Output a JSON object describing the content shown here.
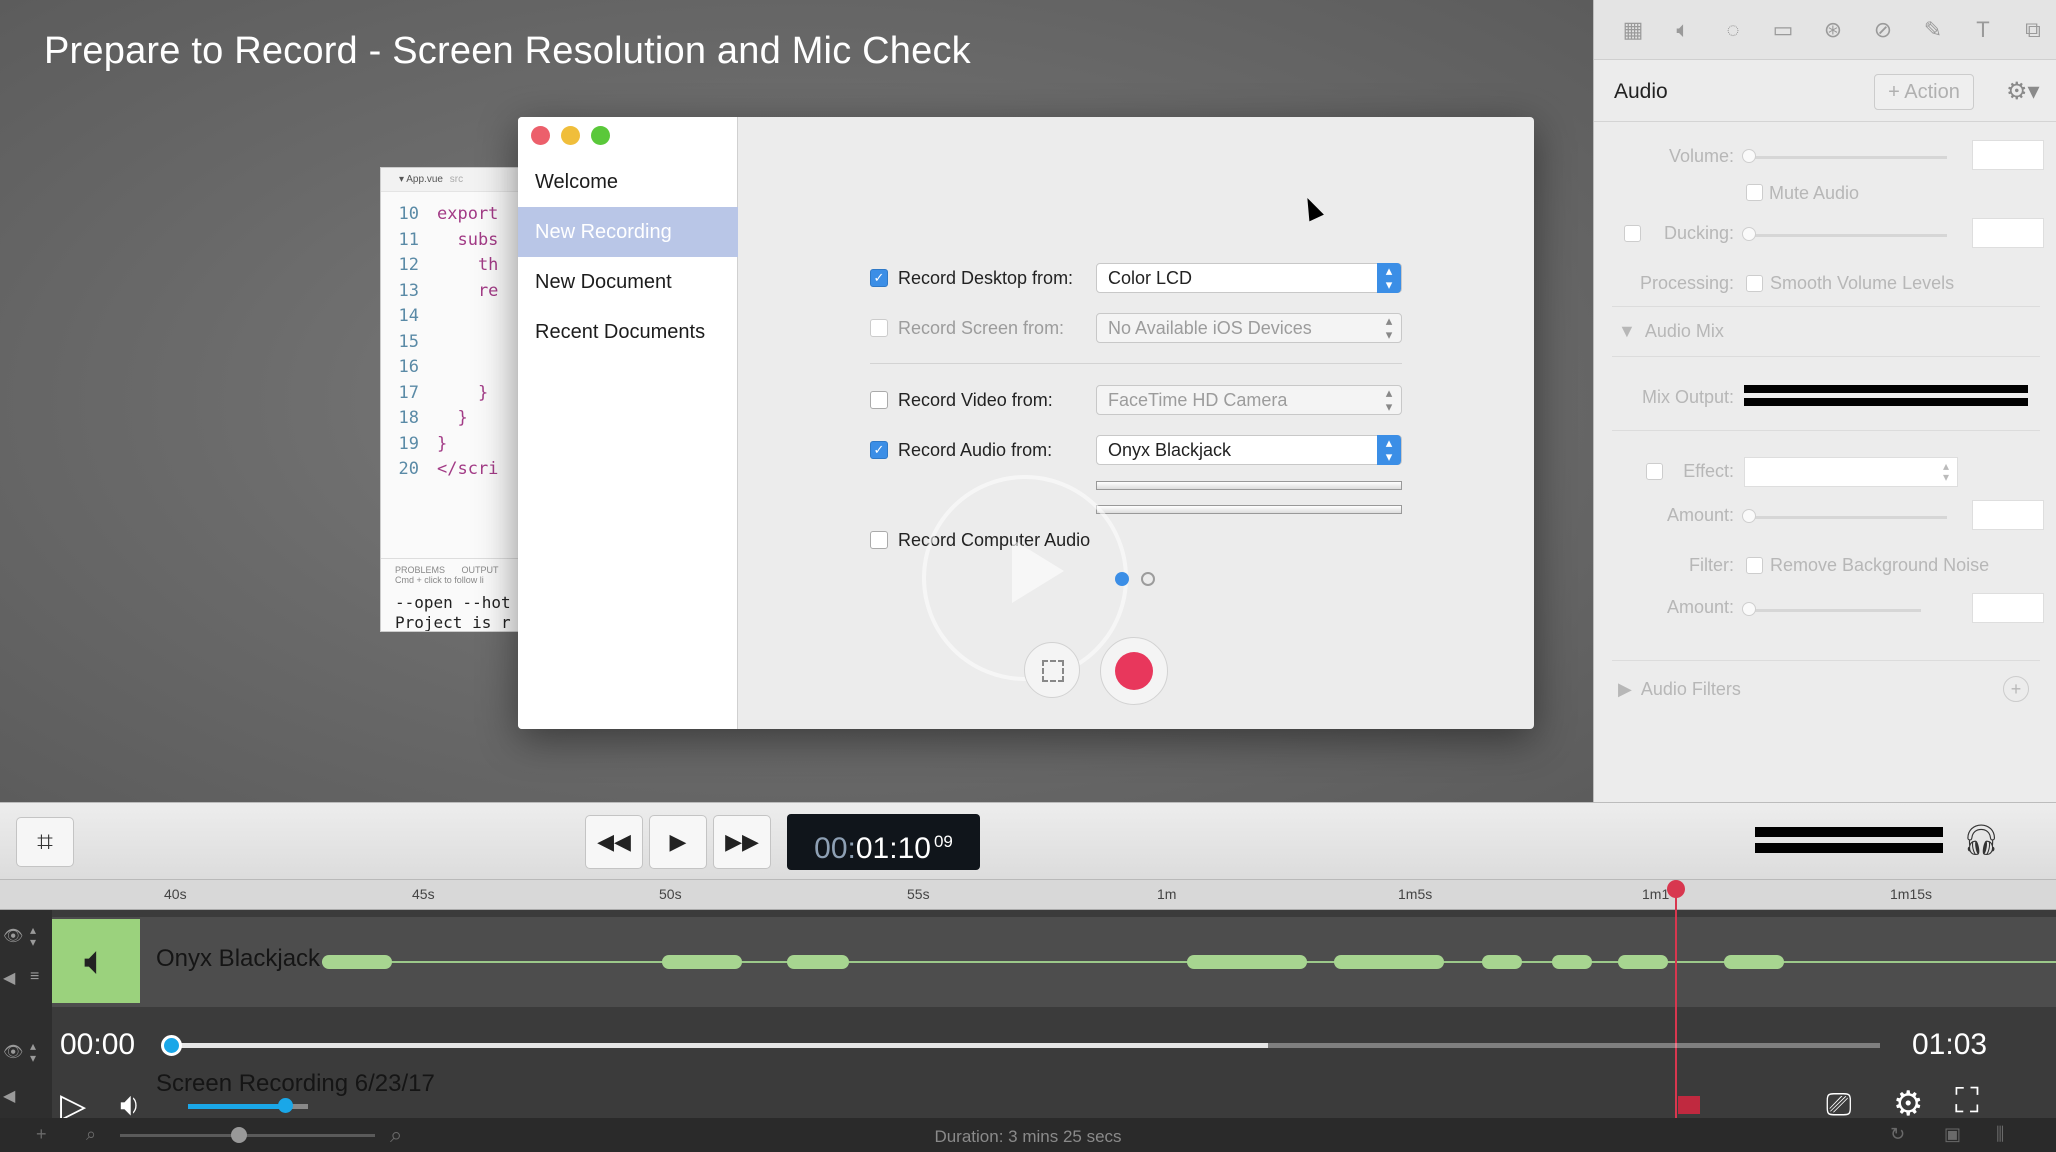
{
  "video": {
    "title": "Prepare to Record - Screen Resolution and Mic Check"
  },
  "editor": {
    "tab_label": "App.vue",
    "tab_dir": "src",
    "line_numbers": [
      "10",
      "11",
      "12",
      "13",
      "14",
      "15",
      "16",
      "17",
      "18",
      "19",
      "20"
    ],
    "code_lines": [
      "export",
      "  subs",
      "    th",
      "    re",
      "",
      "",
      "",
      "    }",
      "  }",
      "}",
      "</scri"
    ],
    "panel_tabs": [
      "PROBLEMS",
      "OUTPUT"
    ],
    "panel_hint": "Cmd + click to follow li",
    "terminal_lines": [
      "--open --hot",
      "Project is r"
    ]
  },
  "dialog": {
    "sidebar": [
      {
        "label": "Welcome",
        "selected": false
      },
      {
        "label": "New Recording",
        "selected": true
      },
      {
        "label": "New Document",
        "selected": false
      },
      {
        "label": "Recent Documents",
        "selected": false
      }
    ],
    "options": {
      "desktop": {
        "label": "Record Desktop from:",
        "checked": true,
        "value": "Color LCD"
      },
      "screen": {
        "label": "Record Screen from:",
        "checked": false,
        "value": "No Available iOS Devices"
      },
      "video": {
        "label": "Record Video from:",
        "checked": false,
        "value": "FaceTime HD Camera"
      },
      "audio": {
        "label": "Record Audio from:",
        "checked": true,
        "value": "Onyx Blackjack"
      },
      "computer_audio": {
        "label": "Record Computer Audio",
        "checked": false
      }
    },
    "record_color": "#e8375c",
    "accent_color": "#3b8ee6"
  },
  "inspector": {
    "toolbar_icons": [
      "media-icon",
      "audio-icon",
      "animation-icon",
      "screen-icon",
      "cursor-icon",
      "transitions-icon",
      "annotation-icon",
      "text-icon",
      "group-icon"
    ],
    "title": "Audio",
    "action_label": "+ Action",
    "volume_label": "Volume:",
    "mute_label": "Mute Audio",
    "ducking_label": "Ducking:",
    "processing_label": "Processing:",
    "smooth_label": "Smooth Volume Levels",
    "audio_mix_label": "Audio Mix",
    "mix_output_label": "Mix Output:",
    "effect_label": "Effect:",
    "amount_label": "Amount:",
    "filter_label": "Filter:",
    "remove_noise_label": "Remove Background Noise",
    "amount2_label": "Amount:",
    "audio_filters_label": "Audio Filters"
  },
  "transport": {
    "timecode_dim": "00:",
    "timecode_main": "01:10",
    "timecode_frames": "09"
  },
  "timeline": {
    "ticks": [
      "40s",
      "45s",
      "50s",
      "55s",
      "1m",
      "1m5s",
      "1m1",
      "1m15s"
    ],
    "audio_track_name": "Onyx Blackjack",
    "screen_track_name": "Screen Recording 6/23/17",
    "playhead_color": "#d8374f",
    "clip_color": "#9bd27d"
  },
  "player": {
    "current_time": "00:00",
    "total_time": "01:03",
    "progress": 0.0,
    "accent_color": "#1aa7e8"
  },
  "status": {
    "duration": "Duration: 3 mins 25 secs"
  }
}
